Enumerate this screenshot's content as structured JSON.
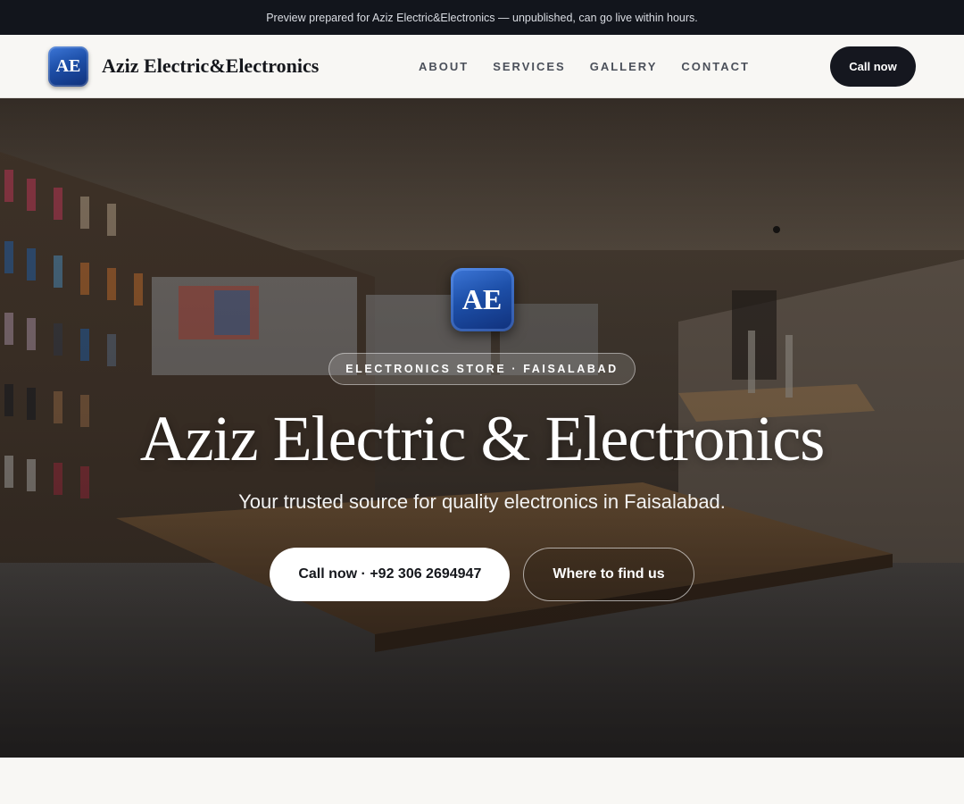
{
  "announcement": "Preview prepared for Aziz Electric&Electronics — unpublished, can go live within hours.",
  "brand": {
    "initials": "AE",
    "name": "Aziz Electric&Electronics",
    "logo_color": "#1d4fa8"
  },
  "nav": {
    "items": [
      {
        "label": "ABOUT"
      },
      {
        "label": "SERVICES"
      },
      {
        "label": "GALLERY"
      },
      {
        "label": "CONTACT"
      }
    ],
    "cta_label": "Call now"
  },
  "hero": {
    "tag": "ELECTRONICS STORE · FAISALABAD",
    "title": "Aziz Electric & Electronics",
    "subtitle": "Your trusted source for quality electronics in Faisalabad.",
    "primary_button": "Call now · +92 306 2694947",
    "secondary_button": "Where to find us"
  },
  "colors": {
    "topbar_bg": "#12151c",
    "nav_bg": "#f8f7f4",
    "cta_bg": "#15171f",
    "accent_blue": "#1d4fa8"
  }
}
